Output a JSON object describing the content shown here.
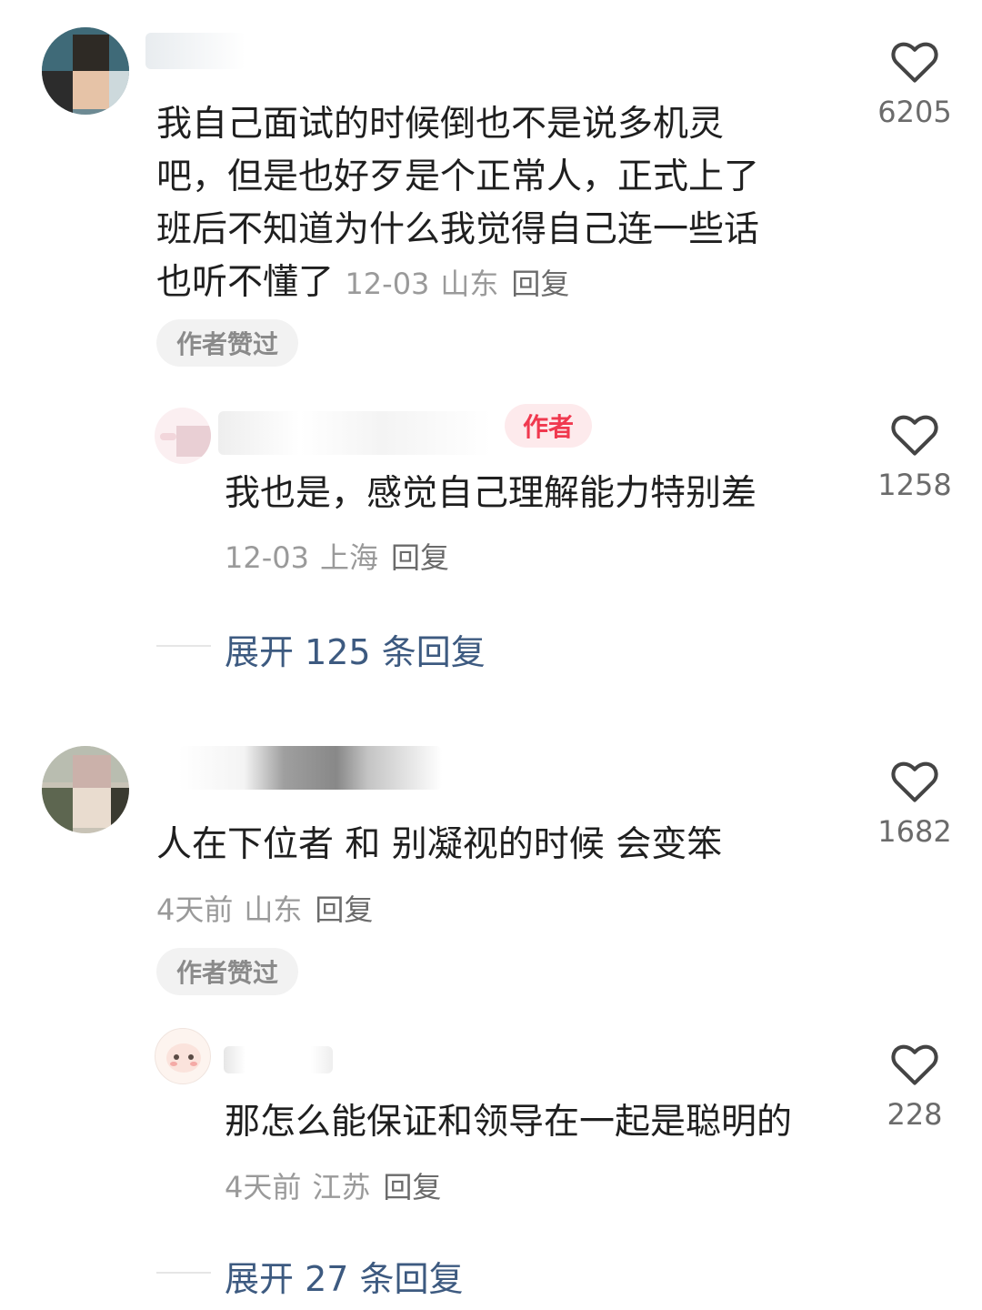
{
  "comments": [
    {
      "content_lines": [
        "我自己面试的时候倒也不是说多机灵",
        "吧，但是也好歹是个正常人，正式上了",
        "班后不知道为什么我觉得自己连一些话",
        "也听不懂了"
      ],
      "date": "12-03",
      "location": "山东",
      "reply_label": "回复",
      "likes": "6205",
      "author_liked_label": "作者赞过",
      "sub_reply": {
        "author_tag": "作者",
        "content": "我也是，感觉自己理解能力特别差",
        "date": "12-03",
        "location": "上海",
        "reply_label": "回复",
        "likes": "1258"
      },
      "expand_label": "展开 125 条回复"
    },
    {
      "content": "人在下位者 和 别凝视的时候 会变笨",
      "date": "4天前",
      "location": "山东",
      "reply_label": "回复",
      "likes": "1682",
      "author_liked_label": "作者赞过",
      "sub_reply": {
        "content": "那怎么能保证和领导在一起是聪明的",
        "date": "4天前",
        "location": "江苏",
        "reply_label": "回复",
        "likes": "228"
      },
      "expand_label": "展开 27 条回复"
    }
  ],
  "icons": {
    "like": "heart-outline-icon"
  },
  "colors": {
    "author_tag": "#f0394f",
    "expand_link": "#3d5a80",
    "meta": "#9a9a9a"
  }
}
